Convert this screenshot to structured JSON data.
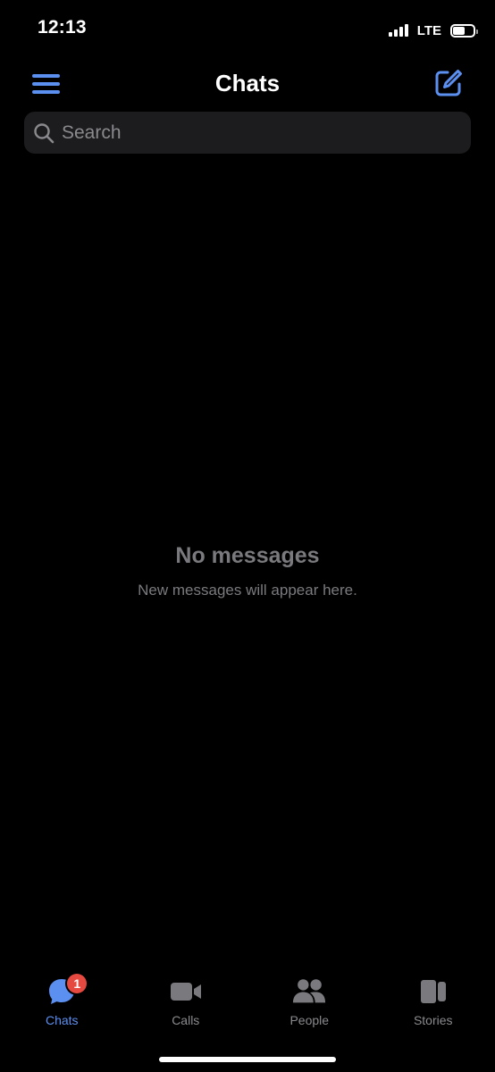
{
  "status_bar": {
    "time": "12:13",
    "network": "LTE",
    "battery_level": 0.6
  },
  "header": {
    "title": "Chats",
    "menu_icon": "hamburger-menu-icon",
    "compose_icon": "compose-icon"
  },
  "search": {
    "placeholder": "Search",
    "value": ""
  },
  "empty_state": {
    "title": "No messages",
    "subtitle": "New messages will appear here."
  },
  "tabs": [
    {
      "label": "Chats",
      "icon": "chat-bubble-icon",
      "active": true,
      "badge": "1"
    },
    {
      "label": "Calls",
      "icon": "video-camera-icon",
      "active": false
    },
    {
      "label": "People",
      "icon": "people-icon",
      "active": false
    },
    {
      "label": "Stories",
      "icon": "stories-icon",
      "active": false
    }
  ],
  "colors": {
    "accent": "#5b8ff0",
    "background": "#000000",
    "search_bg": "#1c1c1e",
    "muted_text": "#7a7a7e",
    "badge": "#e5493f"
  }
}
